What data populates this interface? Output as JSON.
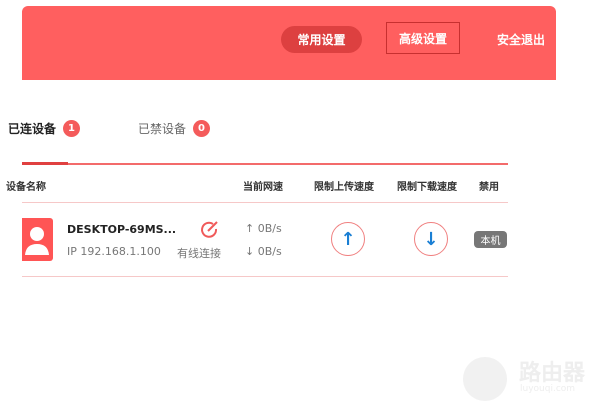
{
  "header": {
    "nav": [
      {
        "label": "常用设置",
        "active": true
      },
      {
        "label": "高级设置",
        "highlighted": true
      },
      {
        "label": "安全退出"
      }
    ]
  },
  "tabs": [
    {
      "label": "已连设备",
      "count": "1",
      "active": true
    },
    {
      "label": "已禁设备",
      "count": "0"
    }
  ],
  "table": {
    "columns": [
      "设备名称",
      "当前网速",
      "限制上传速度",
      "限制下载速度",
      "禁用"
    ],
    "rows": [
      {
        "name": "DESKTOP-69MS...",
        "ip": "IP 192.168.1.100",
        "connection": "有线连接",
        "up": "0B/s",
        "down": "0B/s",
        "tag": "本机"
      }
    ]
  },
  "icons": {
    "up_arrow": "↑",
    "down_arrow": "↓"
  },
  "watermark": {
    "title": "路由器",
    "site": "luyouqi.com"
  },
  "colors": {
    "accent": "#ff5f5f",
    "active_nav": "#dd4040"
  }
}
